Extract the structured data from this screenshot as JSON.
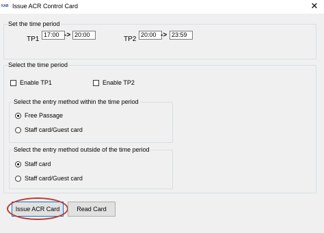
{
  "window": {
    "app_icon_text": "KAB",
    "title": "Issue ACR Control Card",
    "close_glyph": "✕"
  },
  "time_period": {
    "legend": "Set the time period",
    "tp1": {
      "label": "TP1",
      "start": "17:00",
      "end": "20:00"
    },
    "tp2": {
      "label": "TP2",
      "start": "20:00",
      "end": "23:59"
    },
    "arrow": "->"
  },
  "select_period": {
    "legend": "Select the time period",
    "enable_tp1": {
      "label": "Enable TP1",
      "checked": false
    },
    "enable_tp2": {
      "label": "Enable TP2",
      "checked": false
    },
    "within": {
      "legend": "Select the entry method within the time period",
      "options": [
        {
          "label": "Free Passage",
          "selected": true
        },
        {
          "label": "Staff card/Guest card",
          "selected": false
        }
      ]
    },
    "outside": {
      "legend": "Select the entry method outside of the time period",
      "options": [
        {
          "label": "Staff card",
          "selected": true
        },
        {
          "label": "Staff card/Guest card",
          "selected": false
        }
      ]
    }
  },
  "buttons": {
    "issue": "Issue ACR Card",
    "read": "Read Card"
  },
  "highlight_color": "#c0392b"
}
